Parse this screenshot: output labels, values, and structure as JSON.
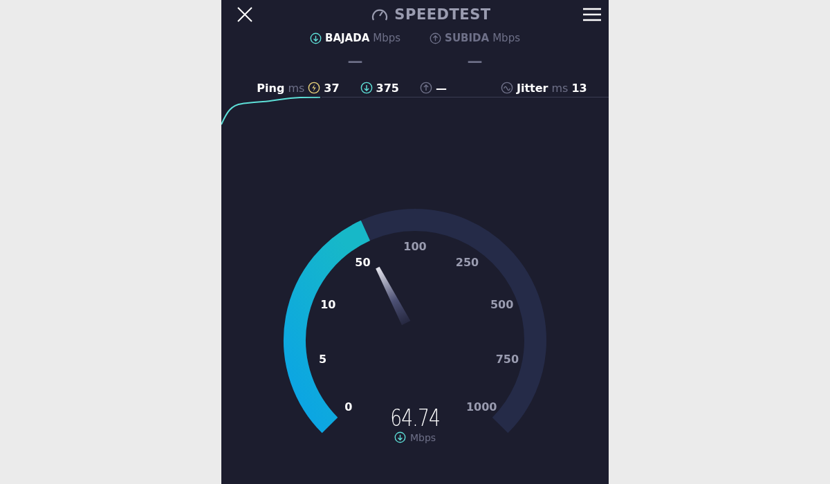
{
  "header": {
    "title": "SPEEDTEST"
  },
  "tabs": [
    {
      "label": "BAJADA",
      "unit": "Mbps",
      "kind": "down",
      "selected": true,
      "value": "—"
    },
    {
      "label": "SUBIDA",
      "unit": "Mbps",
      "kind": "up",
      "selected": false,
      "value": "—"
    }
  ],
  "stats": [
    {
      "kind": "ping",
      "label": "Ping",
      "unit": "ms",
      "value": "37"
    },
    {
      "kind": "down",
      "value": "375"
    },
    {
      "kind": "up",
      "value": "—"
    },
    {
      "kind": "jitter",
      "label": "Jitter",
      "unit": "ms",
      "value": "13"
    }
  ],
  "gauge": {
    "reading": "64.74",
    "unit": "Mbps",
    "ticks": [
      {
        "label": "0",
        "passed": true
      },
      {
        "label": "5",
        "passed": true
      },
      {
        "label": "10",
        "passed": true
      },
      {
        "label": "50",
        "passed": true
      },
      {
        "label": "100",
        "passed": false
      },
      {
        "label": "250",
        "passed": false
      },
      {
        "label": "500",
        "passed": false
      },
      {
        "label": "750",
        "passed": false
      },
      {
        "label": "1000",
        "passed": false
      }
    ]
  }
}
